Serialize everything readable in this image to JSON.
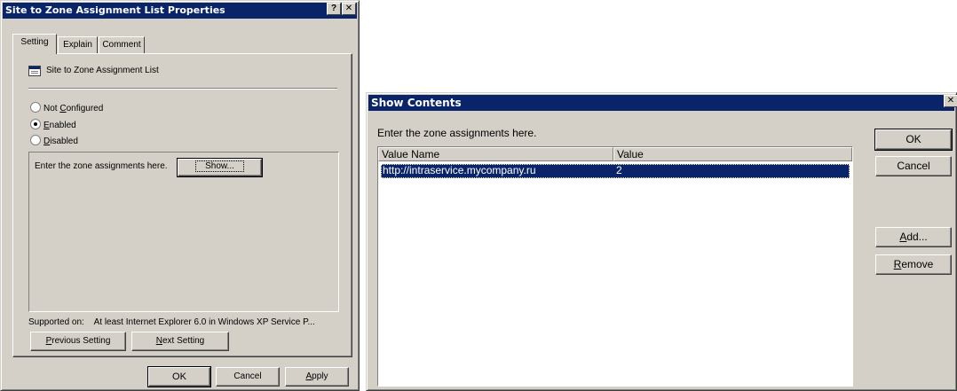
{
  "properties_dialog": {
    "title": "Site to Zone Assignment List Properties",
    "help_button": "?",
    "close_button": "✕",
    "tabs": [
      {
        "label": "Setting"
      },
      {
        "label": "Explain"
      },
      {
        "label": "Comment"
      }
    ],
    "policy_name": "Site to Zone Assignment List",
    "options": {
      "not_configured": {
        "prefix": "Not ",
        "accel": "C",
        "suffix": "onfigured"
      },
      "enabled": {
        "prefix": "",
        "accel": "E",
        "suffix": "nabled"
      },
      "disabled": {
        "prefix": "",
        "accel": "D",
        "suffix": "isabled"
      },
      "selected": "enabled"
    },
    "enter_text": "Enter the zone assignments here.",
    "show_button": "Show...",
    "supported_on_label": "Supported on:",
    "supported_on_value": "At least Internet Explorer 6.0 in Windows XP Service P...",
    "previous_setting": {
      "accel": "P",
      "suffix": "revious Setting"
    },
    "next_setting": {
      "accel": "N",
      "suffix": "ext Setting"
    },
    "ok_button": "OK",
    "cancel_button": "Cancel",
    "apply_button": {
      "accel": "A",
      "suffix": "pply"
    }
  },
  "show_contents_dialog": {
    "title": "Show Contents",
    "close_button": "✕",
    "prompt": "Enter the zone assignments here.",
    "columns": [
      "Value Name",
      "Value"
    ],
    "rows": [
      {
        "name": "http://intraservice.mycompany.ru",
        "value": "2",
        "selected": true
      }
    ],
    "ok_button": "OK",
    "cancel_button": "Cancel",
    "add_button": {
      "accel": "A",
      "suffix": "dd..."
    },
    "remove_button": {
      "accel": "R",
      "suffix": "emove"
    }
  },
  "colors": {
    "titlebar": "#0a246a",
    "face": "#d4d0c8",
    "selection": "#0a246a"
  }
}
